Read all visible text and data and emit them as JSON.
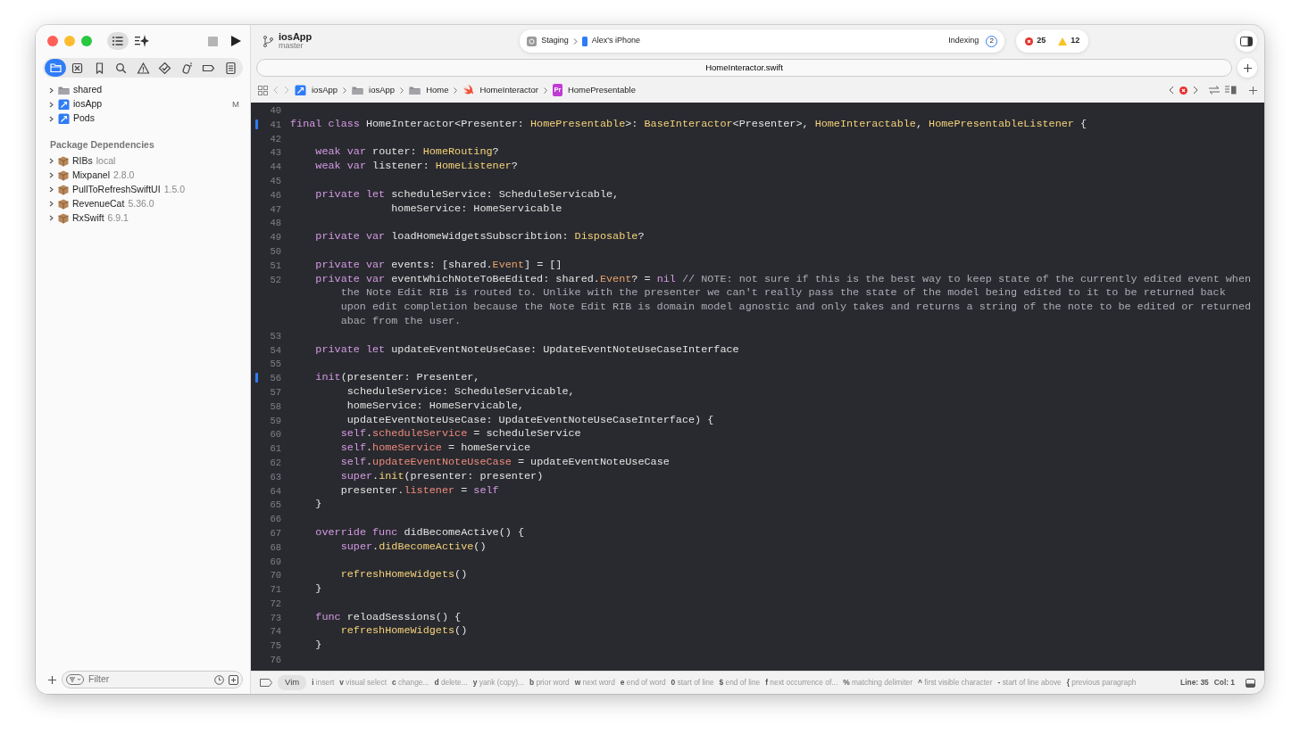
{
  "navigator_tabs": [
    {
      "kind": "folder",
      "selected": true
    },
    {
      "kind": "xbox",
      "selected": false
    },
    {
      "kind": "bookmark",
      "selected": false
    },
    {
      "kind": "search",
      "selected": false
    },
    {
      "kind": "warning",
      "selected": false
    },
    {
      "kind": "diamond",
      "selected": false
    },
    {
      "kind": "spray",
      "selected": false
    },
    {
      "kind": "tag",
      "selected": false
    },
    {
      "kind": "doc",
      "selected": false
    }
  ],
  "project_tree": [
    {
      "label": "shared",
      "kind": "folder",
      "expanded": false
    },
    {
      "label": "iosApp",
      "kind": "app",
      "expanded": false,
      "status": "M"
    },
    {
      "label": "Pods",
      "kind": "app",
      "expanded": false
    }
  ],
  "package_dependencies": {
    "title": "Package Dependencies",
    "items": [
      {
        "name": "RIBs",
        "version": "local",
        "expanded": false
      },
      {
        "name": "Mixpanel",
        "version": "2.8.0",
        "expanded": false
      },
      {
        "name": "PullToRefreshSwiftUI",
        "version": "1.5.0",
        "expanded": false
      },
      {
        "name": "RevenueCat",
        "version": "5.36.0",
        "expanded": false
      },
      {
        "name": "RxSwift",
        "version": "6.9.1",
        "expanded": false
      }
    ]
  },
  "filter": {
    "placeholder": "Filter"
  },
  "toolbar": {
    "project": "iosApp",
    "branch": "master",
    "scheme": "Staging",
    "device": "Alex's iPhone",
    "activity": "Indexing",
    "activity_count": "2",
    "errors": "25",
    "warnings": "12"
  },
  "editor_tab": {
    "title": "HomeInteractor.swift"
  },
  "breadcrumbs": [
    {
      "label": "iosApp",
      "kind": "app"
    },
    {
      "label": "iosApp",
      "kind": "folder"
    },
    {
      "label": "Home",
      "kind": "folder"
    },
    {
      "label": "HomeInteractor",
      "kind": "swift"
    },
    {
      "label": "HomePresentable",
      "kind": "protocol",
      "badge": "Pr"
    }
  ],
  "code_lines": [
    {
      "number": "40",
      "changed": false
    },
    {
      "number": "41",
      "changed": true,
      "tokens": [
        {
          "text": "final class ",
          "kind": "keyword"
        },
        {
          "text": "HomeInteractor<Presenter: ",
          "kind": "plain"
        },
        {
          "text": "HomePresentable",
          "kind": "type"
        },
        {
          "text": ">: ",
          "kind": "plain"
        },
        {
          "text": "BaseInteractor",
          "kind": "type"
        },
        {
          "text": "<Presenter>, ",
          "kind": "plain"
        },
        {
          "text": "HomeInteractable",
          "kind": "type"
        },
        {
          "text": ", ",
          "kind": "plain"
        },
        {
          "text": "HomePresentableListener",
          "kind": "type"
        },
        {
          "text": " {",
          "kind": "plain"
        }
      ]
    },
    {
      "number": "42",
      "changed": false
    },
    {
      "number": "43",
      "changed": false,
      "tokens": [
        {
          "text": "    weak var ",
          "kind": "keyword"
        },
        {
          "text": "router: ",
          "kind": "plain"
        },
        {
          "text": "HomeRouting",
          "kind": "type"
        },
        {
          "text": "?",
          "kind": "plain"
        }
      ]
    },
    {
      "number": "44",
      "changed": false,
      "tokens": [
        {
          "text": "    weak var ",
          "kind": "keyword"
        },
        {
          "text": "listener: ",
          "kind": "plain"
        },
        {
          "text": "HomeListener",
          "kind": "type"
        },
        {
          "text": "?",
          "kind": "plain"
        }
      ]
    },
    {
      "number": "45",
      "changed": false
    },
    {
      "number": "46",
      "changed": false,
      "tokens": [
        {
          "text": "    private let ",
          "kind": "keyword"
        },
        {
          "text": "scheduleService: ScheduleServicable,",
          "kind": "plain"
        }
      ]
    },
    {
      "number": "47",
      "changed": false,
      "tokens": [
        {
          "text": "                homeService: HomeServicable",
          "kind": "plain"
        }
      ]
    },
    {
      "number": "48",
      "changed": false
    },
    {
      "number": "49",
      "changed": false,
      "tokens": [
        {
          "text": "    private var ",
          "kind": "keyword"
        },
        {
          "text": "loadHomeWidgetsSubscribtion: ",
          "kind": "plain"
        },
        {
          "text": "Disposable",
          "kind": "type"
        },
        {
          "text": "?",
          "kind": "plain"
        }
      ]
    },
    {
      "number": "50",
      "changed": false
    },
    {
      "number": "51",
      "changed": false,
      "tokens": [
        {
          "text": "    private var ",
          "kind": "keyword"
        },
        {
          "text": "events: [shared.",
          "kind": "plain"
        },
        {
          "text": "Event",
          "kind": "member"
        },
        {
          "text": "] = []",
          "kind": "plain"
        }
      ]
    },
    {
      "number": "52",
      "changed": false,
      "tokens": [
        {
          "text": "    private var ",
          "kind": "keyword"
        },
        {
          "text": "eventWhichNoteToBeEdited: shared.",
          "kind": "plain"
        },
        {
          "text": "Event",
          "kind": "member"
        },
        {
          "text": "? = ",
          "kind": "plain"
        },
        {
          "text": "nil",
          "kind": "keyword"
        },
        {
          "text": " // NOTE: not sure if this is the best way to keep state of the currently edited event when the Note Edit RIB is routed to. Unlike with the presenter we can't really pass the state of the model being edited to it to be returned back upon edit completion because the Note Edit RIB is domain model agnostic and only takes and returns a string of the note to be edited or returned abac from the user.",
          "kind": "comment"
        }
      ]
    },
    {
      "number": "53",
      "changed": false
    },
    {
      "number": "54",
      "changed": false,
      "tokens": [
        {
          "text": "    private let ",
          "kind": "keyword"
        },
        {
          "text": "updateEventNoteUseCase: UpdateEventNoteUseCaseInterface",
          "kind": "plain"
        }
      ]
    },
    {
      "number": "55",
      "changed": false
    },
    {
      "number": "56",
      "changed": true,
      "tokens": [
        {
          "text": "    init",
          "kind": "keyword"
        },
        {
          "text": "(presenter: Presenter,",
          "kind": "plain"
        }
      ]
    },
    {
      "number": "57",
      "changed": false,
      "tokens": [
        {
          "text": "         scheduleService: ScheduleServicable,",
          "kind": "plain"
        }
      ]
    },
    {
      "number": "58",
      "changed": false,
      "tokens": [
        {
          "text": "         homeService: HomeServicable,",
          "kind": "plain"
        }
      ]
    },
    {
      "number": "59",
      "changed": false,
      "tokens": [
        {
          "text": "         updateEventNoteUseCase: UpdateEventNoteUseCaseInterface) {",
          "kind": "plain"
        }
      ]
    },
    {
      "number": "60",
      "changed": false,
      "tokens": [
        {
          "text": "        self",
          "kind": "keyword"
        },
        {
          "text": ".",
          "kind": "plain"
        },
        {
          "text": "scheduleService",
          "kind": "property"
        },
        {
          "text": " = scheduleService",
          "kind": "plain"
        }
      ]
    },
    {
      "number": "61",
      "changed": false,
      "tokens": [
        {
          "text": "        self",
          "kind": "keyword"
        },
        {
          "text": ".",
          "kind": "plain"
        },
        {
          "text": "homeService",
          "kind": "property"
        },
        {
          "text": " = homeService",
          "kind": "plain"
        }
      ]
    },
    {
      "number": "62",
      "changed": false,
      "tokens": [
        {
          "text": "        self",
          "kind": "keyword"
        },
        {
          "text": ".",
          "kind": "plain"
        },
        {
          "text": "updateEventNoteUseCase",
          "kind": "property"
        },
        {
          "text": " = updateEventNoteUseCase",
          "kind": "plain"
        }
      ]
    },
    {
      "number": "63",
      "changed": false,
      "tokens": [
        {
          "text": "        super",
          "kind": "keyword"
        },
        {
          "text": ".",
          "kind": "plain"
        },
        {
          "text": "init",
          "kind": "call"
        },
        {
          "text": "(presenter: presenter)",
          "kind": "plain"
        }
      ]
    },
    {
      "number": "64",
      "changed": false,
      "tokens": [
        {
          "text": "        presenter.",
          "kind": "plain"
        },
        {
          "text": "listener",
          "kind": "property"
        },
        {
          "text": " = ",
          "kind": "plain"
        },
        {
          "text": "self",
          "kind": "keyword"
        }
      ]
    },
    {
      "number": "65",
      "changed": false,
      "tokens": [
        {
          "text": "    }",
          "kind": "plain"
        }
      ]
    },
    {
      "number": "66",
      "changed": false
    },
    {
      "number": "67",
      "changed": false,
      "tokens": [
        {
          "text": "    override func ",
          "kind": "keyword"
        },
        {
          "text": "didBecomeActive() {",
          "kind": "plain"
        }
      ]
    },
    {
      "number": "68",
      "changed": false,
      "tokens": [
        {
          "text": "        super",
          "kind": "keyword"
        },
        {
          "text": ".",
          "kind": "plain"
        },
        {
          "text": "didBecomeActive",
          "kind": "call"
        },
        {
          "text": "()",
          "kind": "plain"
        }
      ]
    },
    {
      "number": "69",
      "changed": false
    },
    {
      "number": "70",
      "changed": false,
      "tokens": [
        {
          "text": "        refreshHomeWidgets",
          "kind": "call"
        },
        {
          "text": "()",
          "kind": "plain"
        }
      ]
    },
    {
      "number": "71",
      "changed": false,
      "tokens": [
        {
          "text": "    }",
          "kind": "plain"
        }
      ]
    },
    {
      "number": "72",
      "changed": false
    },
    {
      "number": "73",
      "changed": false,
      "tokens": [
        {
          "text": "    func ",
          "kind": "keyword"
        },
        {
          "text": "reloadSessions() {",
          "kind": "plain"
        }
      ]
    },
    {
      "number": "74",
      "changed": false,
      "tokens": [
        {
          "text": "        refreshHomeWidgets",
          "kind": "call"
        },
        {
          "text": "()",
          "kind": "plain"
        }
      ]
    },
    {
      "number": "75",
      "changed": false,
      "tokens": [
        {
          "text": "    }",
          "kind": "plain"
        }
      ]
    },
    {
      "number": "76",
      "changed": false
    }
  ],
  "status_bar": {
    "mode": "Vim",
    "hints": [
      "**i** insert",
      "**v** visual select",
      "**c** change...",
      "**d** delete...",
      "**y** yank (copy)...",
      "**b** prior word",
      "**w** next word",
      "**e** end of word",
      "**0** start of line",
      "**$** end of line",
      "**f** next occurrence of...",
      "**%** matching delimiter",
      "**^** first visible character",
      "**-** start of line above",
      "**{** previous paragraph"
    ],
    "line": "Line: 35",
    "col": "Col: 1"
  }
}
